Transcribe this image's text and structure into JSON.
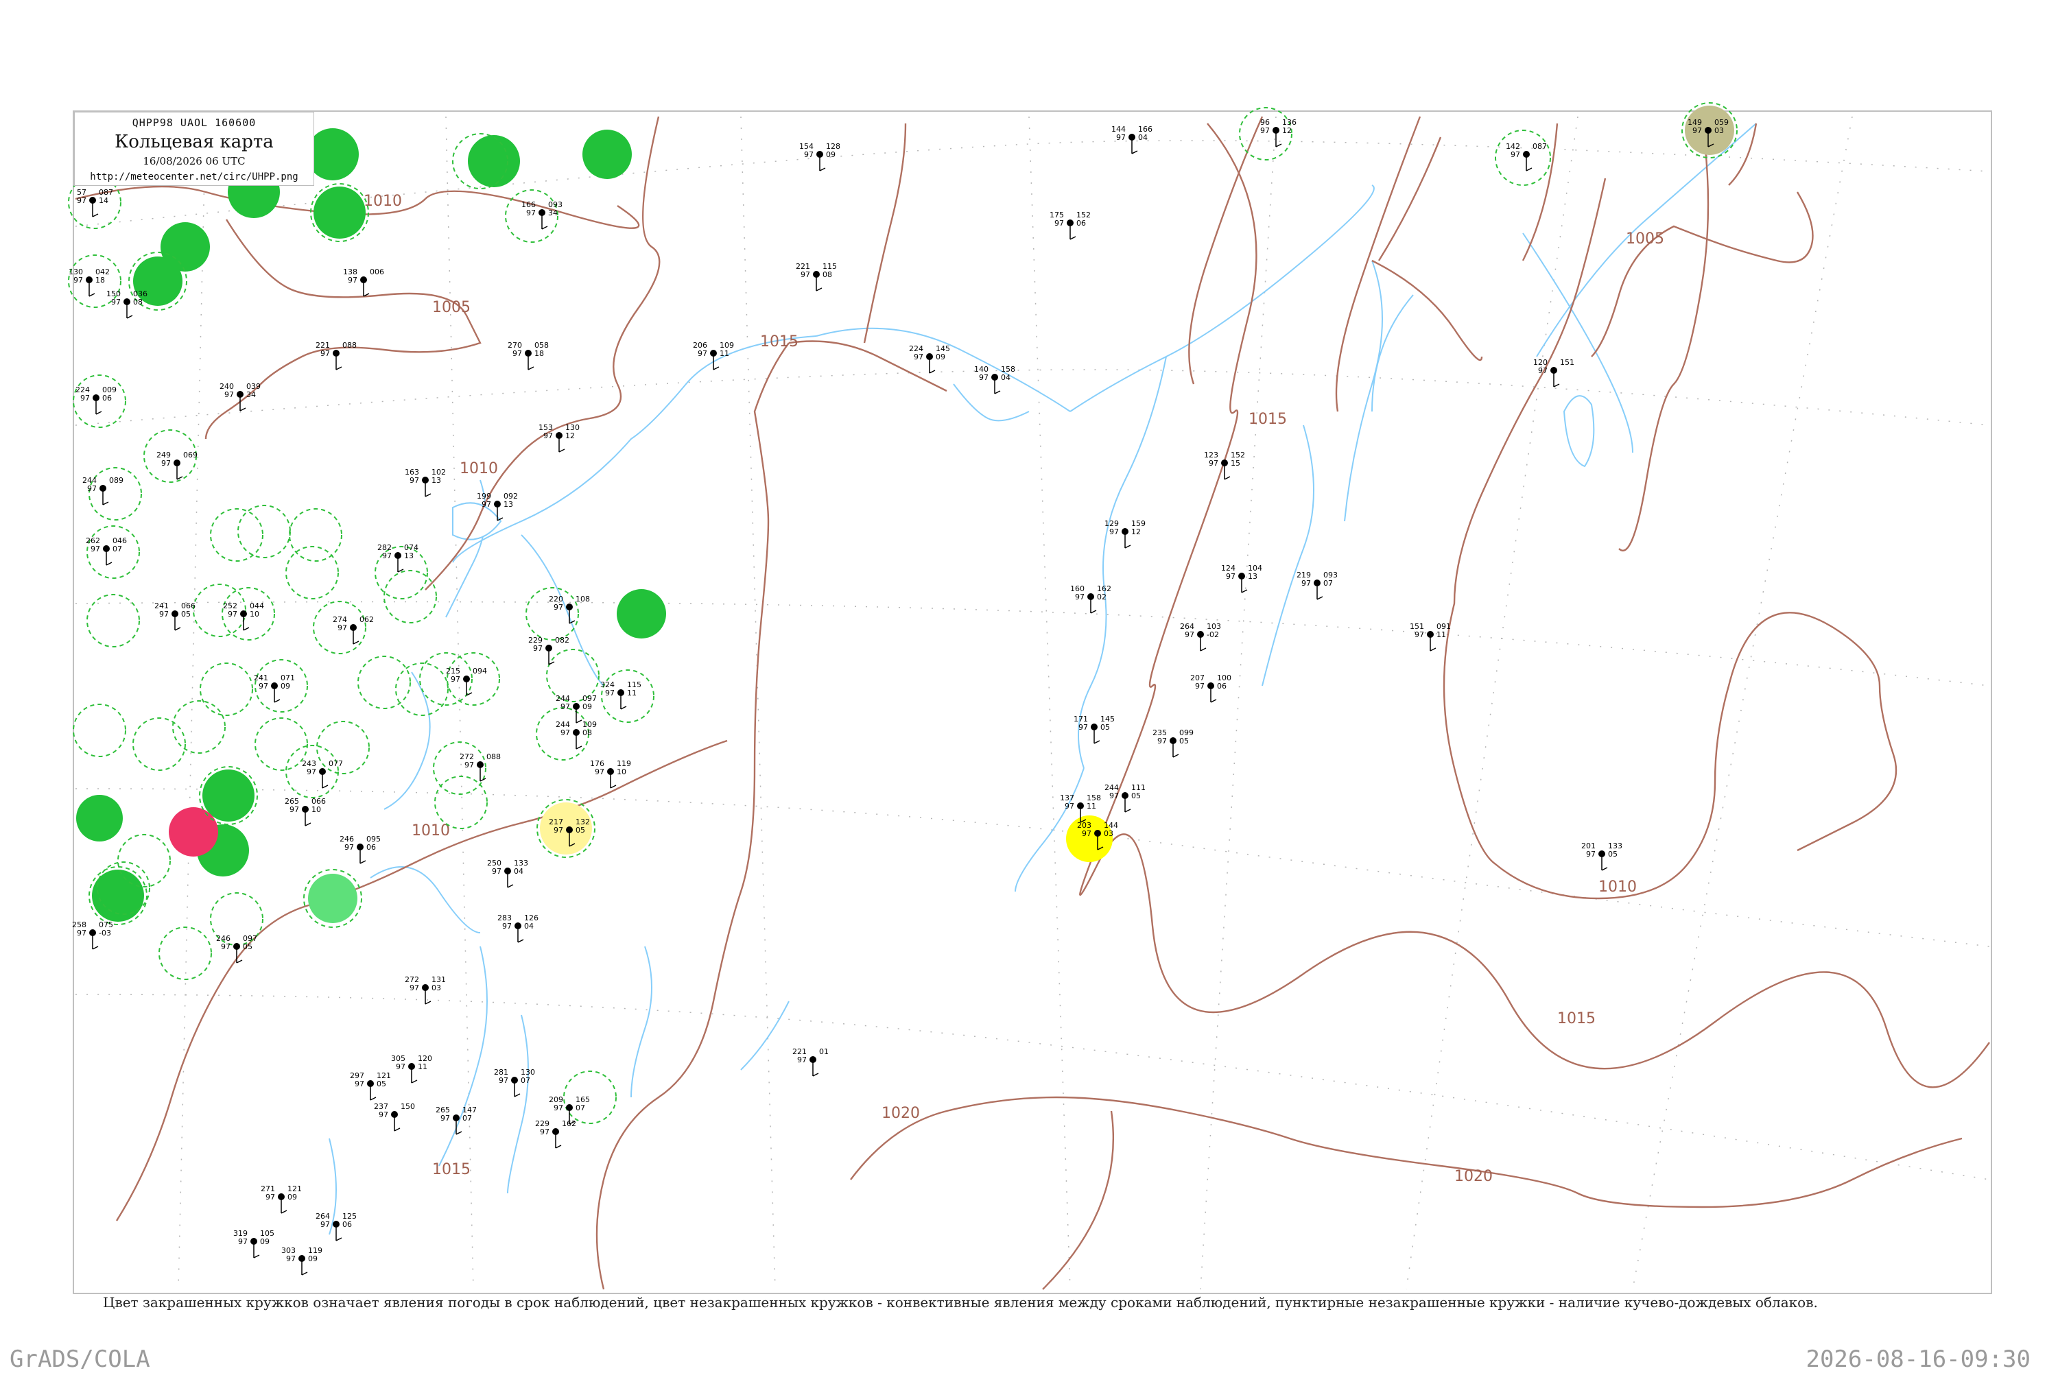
{
  "header": {
    "code": "QHPP98  UAOL  160600",
    "title": "Кольцевая карта",
    "datetime": "16/08/2026 06 UTC",
    "url": "http://meteocenter.net/circ/UHPP.png"
  },
  "footnote": "Цвет закрашенных кружков означает явления погоды в срок наблюдений, цвет незакрашенных кружков - конвективные явления между сроками наблюдений, пунктирные незакрашенные кружки - наличие кучево-дождевых облаков.",
  "footer": {
    "left": "GrADS/COLA",
    "right": "2026-08-16-09:30"
  },
  "colors": {
    "isobar": "#b07060",
    "river": "#87cefa",
    "station": "#000000",
    "thunder": "#22c13a",
    "rain": "#9cf29c",
    "yellow": "#ffff00",
    "pale_yellow": "#fff59a",
    "red": "#ee3366",
    "olive": "#c2bf8e",
    "dashed_ring": "#2fbf3a",
    "frame": "#c0c0c0"
  },
  "isobar_labels": [
    "1010",
    "1005",
    "1010",
    "1015",
    "1015",
    "1005",
    "1010",
    "1010",
    "1015",
    "1020",
    "1020",
    "1015"
  ],
  "station_values": [
    {
      "p": "087",
      "t": "14",
      "d": "57"
    },
    {
      "p": "042",
      "t": "18",
      "d": "130"
    },
    {
      "p": "036",
      "t": "08",
      "d": "150"
    },
    {
      "p": "006",
      "t": "",
      "d": "138"
    },
    {
      "p": "088",
      "t": "",
      "d": "221"
    },
    {
      "p": "039",
      "t": "34",
      "d": "240"
    },
    {
      "p": "009",
      "t": "06",
      "d": "224"
    },
    {
      "p": "069",
      "t": "",
      "d": "249"
    },
    {
      "p": "089",
      "t": "",
      "d": "244"
    },
    {
      "p": "046",
      "t": "07",
      "d": "262"
    },
    {
      "p": "066",
      "t": "05",
      "d": "241"
    },
    {
      "p": "044",
      "t": "10",
      "d": "252"
    },
    {
      "p": "062",
      "t": "",
      "d": "274"
    },
    {
      "p": "074",
      "t": "13",
      "d": "282"
    },
    {
      "p": "102",
      "t": "13",
      "d": "163"
    },
    {
      "p": "092",
      "t": "13",
      "d": "199"
    },
    {
      "p": "058",
      "t": "18",
      "d": "270"
    },
    {
      "p": "130",
      "t": "12",
      "d": "153"
    },
    {
      "p": "093",
      "t": "34",
      "d": "166"
    },
    {
      "p": "108",
      "t": "",
      "d": "220"
    },
    {
      "p": "082",
      "t": "",
      "d": "229"
    },
    {
      "p": "097",
      "t": "09",
      "d": "244"
    },
    {
      "p": "115",
      "t": "11",
      "d": "324"
    },
    {
      "p": "109",
      "t": "08",
      "d": "244"
    },
    {
      "p": "119",
      "t": "10",
      "d": "176"
    },
    {
      "p": "088",
      "t": "",
      "d": "272"
    },
    {
      "p": "132",
      "t": "05",
      "d": "217"
    },
    {
      "p": "133",
      "t": "04",
      "d": "250"
    },
    {
      "p": "126",
      "t": "04",
      "d": "283"
    },
    {
      "p": "128",
      "t": "09",
      "d": "154"
    },
    {
      "p": "109",
      "t": "11",
      "d": "206"
    },
    {
      "p": "115",
      "t": "08",
      "d": "221"
    },
    {
      "p": "145",
      "t": "09",
      "d": "224"
    },
    {
      "p": "158",
      "t": "04",
      "d": "140"
    },
    {
      "p": "152",
      "t": "06",
      "d": "175"
    },
    {
      "p": "166",
      "t": "04",
      "d": "144"
    },
    {
      "p": "136",
      "t": "12",
      "d": "96"
    },
    {
      "p": "087",
      "t": "",
      "d": "142"
    },
    {
      "p": "059",
      "t": "03",
      "d": "149"
    },
    {
      "p": "151",
      "t": "",
      "d": "120"
    },
    {
      "p": "152",
      "t": "15",
      "d": "123"
    },
    {
      "p": "159",
      "t": "12",
      "d": "129"
    },
    {
      "p": "162",
      "t": "02",
      "d": "160"
    },
    {
      "p": "104",
      "t": "13",
      "d": "124"
    },
    {
      "p": "093",
      "t": "07",
      "d": "219"
    },
    {
      "p": "103",
      "t": "-02",
      "d": "264"
    },
    {
      "p": "091",
      "t": "11",
      "d": "151"
    },
    {
      "p": "100",
      "t": "06",
      "d": "207"
    },
    {
      "p": "145",
      "t": "05",
      "d": "171"
    },
    {
      "p": "099",
      "t": "05",
      "d": "235"
    },
    {
      "p": "111",
      "t": "05",
      "d": "244"
    },
    {
      "p": "158",
      "t": "11",
      "d": "137"
    },
    {
      "p": "144",
      "t": "03",
      "d": "203"
    },
    {
      "p": "133",
      "t": "05",
      "d": "201"
    },
    {
      "p": "01",
      "t": "",
      "d": "221"
    },
    {
      "p": "131",
      "t": "03",
      "d": "272"
    },
    {
      "p": "120",
      "t": "11",
      "d": "305"
    },
    {
      "p": "130",
      "t": "07",
      "d": "281"
    },
    {
      "p": "165",
      "t": "07",
      "d": "209"
    },
    {
      "p": "162",
      "t": "",
      "d": "229"
    },
    {
      "p": "121",
      "t": "05",
      "d": "297"
    },
    {
      "p": "150",
      "t": "",
      "d": "237"
    },
    {
      "p": "147",
      "t": "07",
      "d": "265"
    },
    {
      "p": "125",
      "t": "06",
      "d": "264"
    },
    {
      "p": "119",
      "t": "09",
      "d": "303"
    },
    {
      "p": "105",
      "t": "09",
      "d": "319"
    },
    {
      "p": "121",
      "t": "09",
      "d": "271"
    },
    {
      "p": "097",
      "t": "05",
      "d": "246"
    },
    {
      "p": "075",
      "t": "-03",
      "d": "258"
    },
    {
      "p": "095",
      "t": "06",
      "d": "246"
    },
    {
      "p": "066",
      "t": "10",
      "d": "265"
    },
    {
      "p": "077",
      "t": "",
      "d": "243"
    },
    {
      "p": "071",
      "t": "09",
      "d": "241"
    },
    {
      "p": "094",
      "t": "",
      "d": "215"
    }
  ]
}
